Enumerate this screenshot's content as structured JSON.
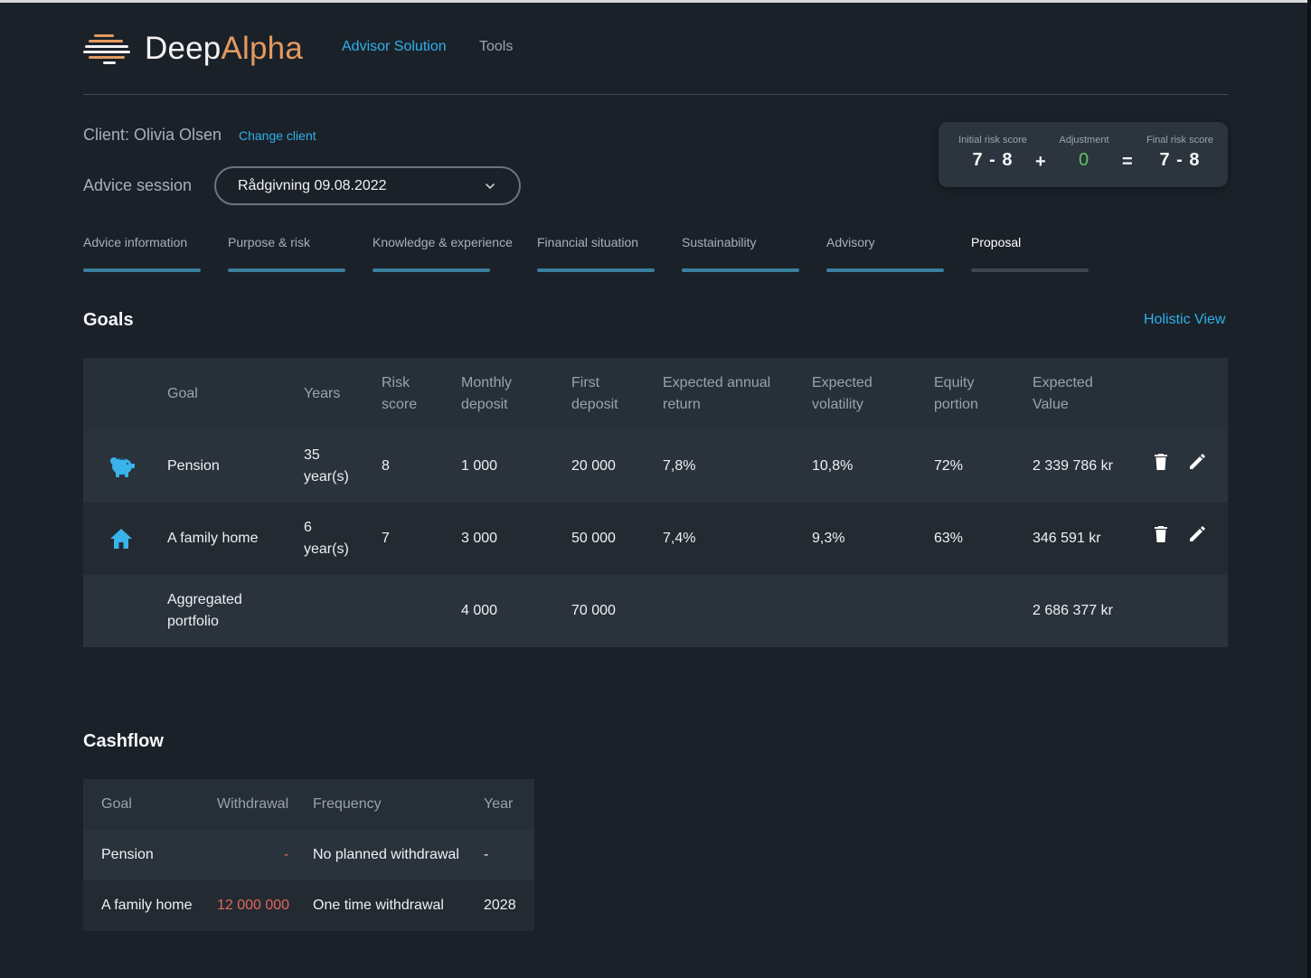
{
  "brand": {
    "name_part1": "Deep",
    "name_part2": "Alpha",
    "accent_color": "#e39a5f",
    "link_color": "#2fb1ea"
  },
  "nav": {
    "items": [
      {
        "label": "Advisor Solution",
        "active": true
      },
      {
        "label": "Tools",
        "active": false
      }
    ]
  },
  "client": {
    "label": "Client: Olivia Olsen",
    "change_label": "Change client"
  },
  "session": {
    "label": "Advice session",
    "selected": "Rådgivning 09.08.2022"
  },
  "risk": {
    "initial_label": "Initial risk score",
    "initial_value": "7 - 8",
    "plus": "+",
    "adjustment_label": "Adjustment",
    "adjustment_value": "0",
    "equals": "=",
    "final_label": "Final risk score",
    "final_value": "7 - 8"
  },
  "tabs": [
    {
      "label": "Advice information"
    },
    {
      "label": "Purpose & risk"
    },
    {
      "label": "Knowledge & experience"
    },
    {
      "label": "Financial situation"
    },
    {
      "label": "Sustainability"
    },
    {
      "label": "Advisory"
    },
    {
      "label": "Proposal"
    }
  ],
  "goals": {
    "title": "Goals",
    "holistic_link": "Holistic View",
    "headers": {
      "goal": "Goal",
      "years": "Years",
      "risk_1": "Risk",
      "risk_2": "score",
      "monthly_1": "Monthly",
      "monthly_2": "deposit",
      "first_1": "First",
      "first_2": "deposit",
      "return_1": "Expected annual",
      "return_2": "return",
      "vol_1": "Expected",
      "vol_2": "volatility",
      "equity_1": "Equity",
      "equity_2": "portion",
      "value_1": "Expected",
      "value_2": "Value"
    },
    "rows": [
      {
        "icon": "piggy-bank-icon",
        "goal": "Pension",
        "years_1": "35",
        "years_2": "year(s)",
        "risk": "8",
        "monthly": "1 000",
        "first": "20 000",
        "return": "7,8%",
        "volatility": "10,8%",
        "equity": "72%",
        "value": "2 339 786 kr"
      },
      {
        "icon": "home-icon",
        "goal": "A family home",
        "years_1": "6",
        "years_2": "year(s)",
        "risk": "7",
        "monthly": "3 000",
        "first": "50 000",
        "return": "7,4%",
        "volatility": "9,3%",
        "equity": "63%",
        "value": "346 591 kr"
      }
    ],
    "aggregate": {
      "label_1": "Aggregated",
      "label_2": "portfolio",
      "monthly": "4 000",
      "first": "70 000",
      "value": "2 686 377 kr"
    }
  },
  "cashflow": {
    "title": "Cashflow",
    "headers": {
      "goal": "Goal",
      "withdrawal": "Withdrawal",
      "frequency": "Frequency",
      "year": "Year"
    },
    "rows": [
      {
        "goal": "Pension",
        "withdrawal": "-",
        "frequency": "No planned withdrawal",
        "year": "-"
      },
      {
        "goal": "A family home",
        "withdrawal": "12 000 000",
        "frequency": "One time withdrawal",
        "year": "2028"
      }
    ],
    "withdrawal_color": "#e0675d"
  }
}
